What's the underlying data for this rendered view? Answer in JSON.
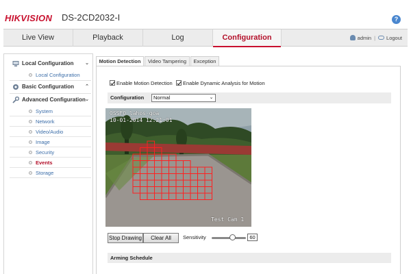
{
  "header": {
    "logo": "HIKVISION",
    "model": "DS-2CD2032-I",
    "help_icon": "?"
  },
  "nav": {
    "tabs": [
      {
        "label": "Live View"
      },
      {
        "label": "Playback"
      },
      {
        "label": "Log"
      },
      {
        "label": "Configuration",
        "active": true
      }
    ],
    "user": "admin",
    "separator": "|",
    "logout": "Logout"
  },
  "sidebar": {
    "local_configuration": "Local Configuration",
    "local_sub": "Local Configuration",
    "basic_configuration": "Basic Configuration",
    "advanced_configuration": "Advanced Configuration",
    "items": [
      {
        "label": "System"
      },
      {
        "label": "Network"
      },
      {
        "label": "Video/Audio"
      },
      {
        "label": "Image"
      },
      {
        "label": "Security"
      },
      {
        "label": "Events",
        "active": true
      },
      {
        "label": "Storage"
      }
    ],
    "chevrons": {
      "local": "⌄",
      "basic": "⌃",
      "advanced": "⌄"
    }
  },
  "subtabs": [
    {
      "label": "Motion Detection",
      "active": true
    },
    {
      "label": "Video Tampering"
    },
    {
      "label": "Exception"
    }
  ],
  "motion": {
    "enable_label": "Enable Motion Detection",
    "enable_checked": true,
    "dynamic_label": "Enable Dynamic Analysis for Motion",
    "dynamic_checked": true,
    "configuration_label": "Configuration",
    "configuration_value": "Normal",
    "osd_top": "OSSFO lahos-goa",
    "osd_date": "10-01-2014 12:21:01",
    "osd_camera": "Test Cam 1",
    "stop_drawing": "Stop Drawing",
    "clear_all": "Clear All",
    "sensitivity_label": "Sensitivity",
    "sensitivity_value": "60",
    "sensitivity_fraction": 0.6,
    "arming_schedule": "Arming Schedule"
  },
  "colors": {
    "brand_red": "#c8102e",
    "active_text": "#b3102a",
    "link_blue": "#3b6da8",
    "grid_red": "#ff2020"
  }
}
